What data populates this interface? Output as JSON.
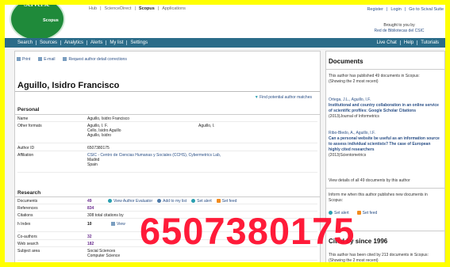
{
  "header": {
    "logo_text": "SciVerse",
    "logo_sub": "Scopus",
    "top_links": [
      "Hub",
      "|",
      "ScienceDirect",
      "|",
      "Scopus",
      "|",
      "Applications"
    ],
    "user_links": [
      "Register",
      "|",
      "Login",
      "|",
      "Go to Scival Suite"
    ],
    "brought_line1": "Brought to you by",
    "brought_line2": "Red de Bibliotecas del CSIC"
  },
  "nav": {
    "items": [
      "Search",
      "Sources",
      "Analytics",
      "Alerts",
      "My list",
      "Settings"
    ],
    "right": [
      "Live Chat",
      "Help",
      "Tutorials"
    ]
  },
  "tools": [
    "Print",
    "E-mail",
    "Request author detail corrections"
  ],
  "author_name": "Aguillo, Isidro Francisco",
  "potential_link": "Find potential author matches",
  "personal": {
    "heading": "Personal",
    "name_label": "Name",
    "name_value": "Aguillo, Isidro Francisco",
    "other_label": "Other formats",
    "other_values": [
      "Aguillo, I. F.",
      "Cello, Isidro Aguillo",
      "Aguillo, Isidro"
    ],
    "other_right": "Aguillo, I.",
    "id_label": "Author ID",
    "id_value": "6507380175",
    "aff_label": "Affiliation",
    "aff_values": [
      "CSIC - Centro de Ciencias Humanas y Sociales (CCHS), Cybermetrics Lab,",
      "Madrid",
      "Spain"
    ]
  },
  "research": {
    "heading": "Research",
    "docs_label": "Documents",
    "docs_value": "49",
    "docs_actions": [
      "View Author Evaluator",
      "Add to my list",
      "Set alert",
      "Set feed"
    ],
    "refs_label": "References",
    "refs_value": "834",
    "cit_label": "Citations",
    "cit_value": "308 total citations by",
    "h_label": "h Index",
    "h_value": "10",
    "h_action": "View",
    "co_label": "Co-authors",
    "co_value": "32",
    "web_label": "Web search",
    "web_value": "182",
    "subj_label": "Subject area",
    "subj_values": [
      "Social Sciences",
      "Computer Science"
    ]
  },
  "sidebar": {
    "title": "Documents",
    "intro": "This author has published 49 documents in Scopus:",
    "intro2": "(Showing the 2 most recent)",
    "doc1_authors": "Ortega, J.L., Aguillo, I.F.",
    "doc1_title": "Institutional and country collaboration in an online service of scientific profiles: Google Scholar Citations",
    "doc1_source": "(2013)Journal of Informetrics",
    "doc2_authors": "Ribo-Bledo, A., Aguillo, I.F.",
    "doc2_title": "Can a personal website be useful as an information source to assess individual scientists? The case of European highly cited researchers",
    "doc2_source": "(2013)Scientometrics",
    "view_all": "View details of all 49 documents by this author",
    "inform": "Inform me when this author publishes new documents in Scopus:",
    "alert": "Set alert",
    "feed": "Set feed",
    "cited_title": "Cited by since 1996",
    "cited_text": "This author has been cited by 213 documents in Scopus:",
    "cited_text2": "(Showing the 2 most recent)"
  },
  "watermark": "6507380175",
  "colors": {
    "nav_bg": "#2b6c89",
    "logo_green": "#1f8a3a",
    "link_blue": "#2a4f86",
    "border_yellow": "#ffff00",
    "watermark_red": "#ff0f2f"
  }
}
